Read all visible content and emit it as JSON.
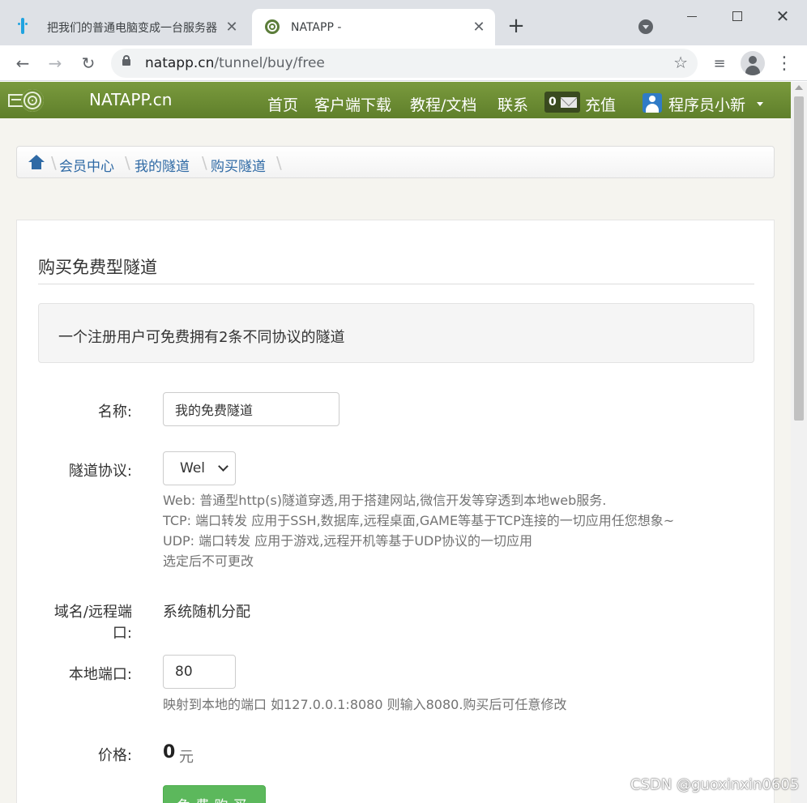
{
  "browser": {
    "tabs": [
      {
        "title": "把我们的普通电脑变成一台服务器",
        "active": false,
        "favicon": "bilibili-icon"
      },
      {
        "title": "NATAPP -",
        "active": true,
        "favicon": "natapp-ring-icon"
      }
    ],
    "url_host": "natapp.cn",
    "url_path": "/tunnel/buy/free"
  },
  "site": {
    "brand": "NATAPP.cn",
    "nav": {
      "home": "首页",
      "download": "客户端下载",
      "docs": "教程/文档",
      "contact": "联系",
      "message_count": "0",
      "recharge": "充值",
      "username": "程序员小新"
    },
    "colors": {
      "navbar": "#6f8f35",
      "link": "#2f6aa5",
      "buy_button": "#5cb85c"
    }
  },
  "breadcrumb": [
    "会员中心",
    "我的隧道",
    "购买隧道"
  ],
  "form": {
    "title": "购买免费型隧道",
    "notice": "一个注册用户可免费拥有2条不同协议的隧道",
    "name_label": "名称:",
    "name_value": "我的免费隧道",
    "protocol_label": "隧道协议:",
    "protocol_value": "Wel",
    "protocol_help": [
      "Web: 普通型http(s)隧道穿透,用于搭建网站,微信开发等穿透到本地web服务.",
      "TCP: 端口转发 应用于SSH,数据库,远程桌面,GAME等基于TCP连接的一切应用任您想象~",
      "UDP: 端口转发 应用于游戏,远程开机等基于UDP协议的一切应用",
      "选定后不可更改"
    ],
    "domain_label_line1": "域名/远程端",
    "domain_label_line2": "口:",
    "domain_value": "系统随机分配",
    "port_label": "本地端口:",
    "port_value": "80",
    "port_help": "映射到本地的端口 如127.0.0.1:8080 则输入8080.购买后可任意修改",
    "price_label": "价格:",
    "price_value": "0",
    "price_unit": "元",
    "buy_button": "免费购买"
  },
  "watermark": "CSDN @guoxinxin0605"
}
